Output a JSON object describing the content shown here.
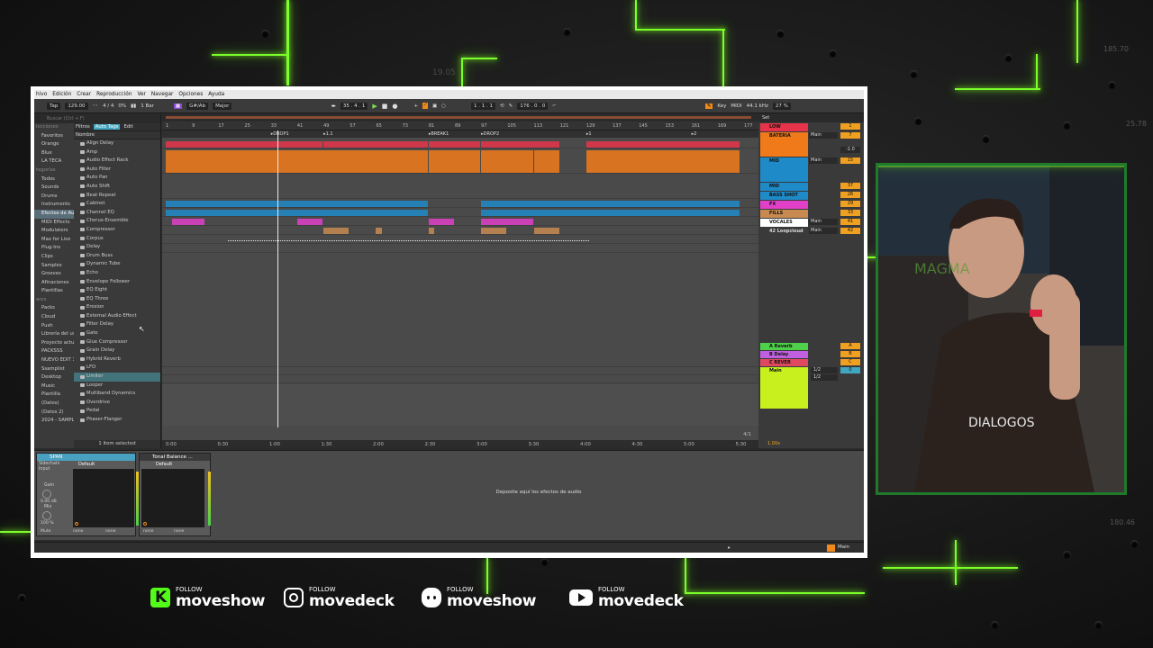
{
  "menu": [
    "hivo",
    "Edición",
    "Crear",
    "Reproducción",
    "Ver",
    "Navegar",
    "Opciones",
    "Ayuda"
  ],
  "transport": {
    "tap": "Tap",
    "tempo": "129.00",
    "signature": "4 / 4",
    "metro": "0%",
    "quant": "1 Bar",
    "key": "G#/Ab",
    "scale": "Major",
    "position": "35 .  4 .  1",
    "loop_start": "1 .  1 .  1",
    "loop_len": "176 .  0 .  0",
    "key_btn": "Key",
    "midi_btn": "MIDI",
    "sample_rate": "44.1 kHz",
    "cpu": "27 %"
  },
  "browser": {
    "search": "Buscar (Ctrl + F)",
    "filters": "Filtros",
    "auto_tags": "Auto Tags",
    "edit": "Edit",
    "name_header": "Nombre",
    "places": [
      {
        "label": "lecciones",
        "hdr": true
      },
      {
        "label": "Favoritos"
      },
      {
        "label": "Orange"
      },
      {
        "label": "Blue"
      },
      {
        "label": "LA TECA"
      },
      {
        "label": "tegorías",
        "hdr": true
      },
      {
        "label": "Todos"
      },
      {
        "label": "Sounds"
      },
      {
        "label": "Drums"
      },
      {
        "label": "Instruments"
      },
      {
        "label": "Efectos de Aud",
        "sel": true
      },
      {
        "label": "MIDI Effects"
      },
      {
        "label": "Modulators"
      },
      {
        "label": "Max for Live"
      },
      {
        "label": "Plug-Ins"
      },
      {
        "label": "Clips"
      },
      {
        "label": "Samples"
      },
      {
        "label": "Grooves"
      },
      {
        "label": "Afinaciones"
      },
      {
        "label": "Plantillas"
      },
      {
        "label": "ares",
        "hdr": true
      },
      {
        "label": "Packs"
      },
      {
        "label": "Cloud"
      },
      {
        "label": "Push"
      },
      {
        "label": "Librería del usu"
      },
      {
        "label": "Proyecto actua"
      },
      {
        "label": "PACKSSS"
      },
      {
        "label": "NUEVO EDIT 3C"
      },
      {
        "label": "Ssamplist"
      },
      {
        "label": "Desktop"
      },
      {
        "label": "Music"
      },
      {
        "label": "Plantilla"
      },
      {
        "label": "(Datos)"
      },
      {
        "label": "(Datos 2)"
      },
      {
        "label": "2024 - SAMPLE"
      }
    ],
    "items": [
      "Align Delay",
      "Amp",
      "Audio Effect Rack",
      "Auto Filter",
      "Auto Pan",
      "Auto Shift",
      "Beat Repeat",
      "Cabinet",
      "Channel EQ",
      "Chorus-Ensemble",
      "Compressor",
      "Corpus",
      "Delay",
      "Drum Buss",
      "Dynamic Tube",
      "Echo",
      "Envelope Follower",
      "EQ Eight",
      "EQ Three",
      "Erosion",
      "External Audio Effect",
      "Filter Delay",
      "Gate",
      "Glue Compressor",
      "Grain Delay",
      "Hybrid Reverb",
      "LFO",
      "Limiter",
      "Looper",
      "Multiband Dynamics",
      "Overdrive",
      "Pedal",
      "Phaser-Flanger"
    ],
    "selected_index": 27,
    "status": "1 Item selected"
  },
  "arrangement": {
    "bars": [
      "1",
      "9",
      "17",
      "25",
      "33",
      "41",
      "49",
      "57",
      "65",
      "73",
      "81",
      "89",
      "97",
      "105",
      "113",
      "121",
      "129",
      "137",
      "145",
      "153",
      "161",
      "169",
      "177"
    ],
    "locators": [
      {
        "label": "DROP1",
        "bar": 33
      },
      {
        "label": "1.1",
        "bar": 49
      },
      {
        "label": "BREAK1",
        "bar": 81
      },
      {
        "label": "DROP2",
        "bar": 97
      },
      {
        "label": "1",
        "bar": 129
      },
      {
        "label": "2",
        "bar": 161
      }
    ],
    "times": [
      "0:00",
      "0:30",
      "1:00",
      "1:30",
      "2:00",
      "2:30",
      "3:00",
      "3:30",
      "4:00",
      "4:30",
      "5:00",
      "5:30"
    ],
    "zoom": "4/1"
  },
  "mixer": {
    "set_label": "Set",
    "tracks": [
      {
        "name": "LOW",
        "color": "#e8344a",
        "route": "",
        "vol": "1"
      },
      {
        "name": "BATERIA",
        "color": "#f07a1a",
        "route": "Main",
        "vol": "7"
      },
      {
        "name": "MID",
        "color": "#1e8ac8",
        "route": "Main",
        "vol": "15"
      },
      {
        "name": "MID",
        "color": "#1e8ac8",
        "route": "",
        "vol": "37"
      },
      {
        "name": "BASS SHOT",
        "color": "#1e8ac8",
        "route": "",
        "vol": "26"
      },
      {
        "name": "FX",
        "color": "#e040c8",
        "route": "",
        "vol": "29"
      },
      {
        "name": "FILLS",
        "color": "#c88a50",
        "route": "",
        "vol": "33"
      },
      {
        "name": "VOCALES",
        "color": "#ffffff",
        "route": "Main",
        "vol": "41"
      },
      {
        "name": "42 Loopcloud",
        "color": "#3a3a3a",
        "route": "Main",
        "vol": "42"
      }
    ],
    "returns": [
      {
        "name": "A Reverb",
        "color": "#4ed04a",
        "vol": "A"
      },
      {
        "name": "B Delay",
        "color": "#c060e0",
        "vol": "B"
      },
      {
        "name": "C REVER CORTA",
        "color": "#e04860",
        "vol": "C"
      }
    ],
    "main": {
      "name": "Main",
      "color": "#c8f01e",
      "vol": "0"
    },
    "cue_a": "1/2",
    "cue_b": "1/2",
    "ratio": "1.00x",
    "vol_readout": "-1.0"
  },
  "devices": {
    "dev1": "SPAN",
    "dev2": "Tonal Balance ...",
    "preset": "Default",
    "sidechain": "Sidechain",
    "input": "Input",
    "gain": "Gain",
    "gain_val": "0.00 dB",
    "mix": "Mix",
    "mix_val": "100 %",
    "mute": "Mute",
    "none": "none",
    "drop_hint": "Deposite aquí los efectos de audio",
    "status_main": "Main"
  },
  "social": [
    {
      "follow": "FOLLOW",
      "name": "moveshow",
      "icon": "kick-icon"
    },
    {
      "follow": "FOLLOW",
      "name": "movedeck",
      "icon": "instagram-icon"
    },
    {
      "follow": "FOLLOW",
      "name": "moveshow",
      "icon": "discord-icon"
    },
    {
      "follow": "FOLLOW",
      "name": "movedeck",
      "icon": "youtube-icon"
    }
  ],
  "bg_labels": [
    "19.05",
    "185.70",
    "25.78",
    "180.46"
  ]
}
